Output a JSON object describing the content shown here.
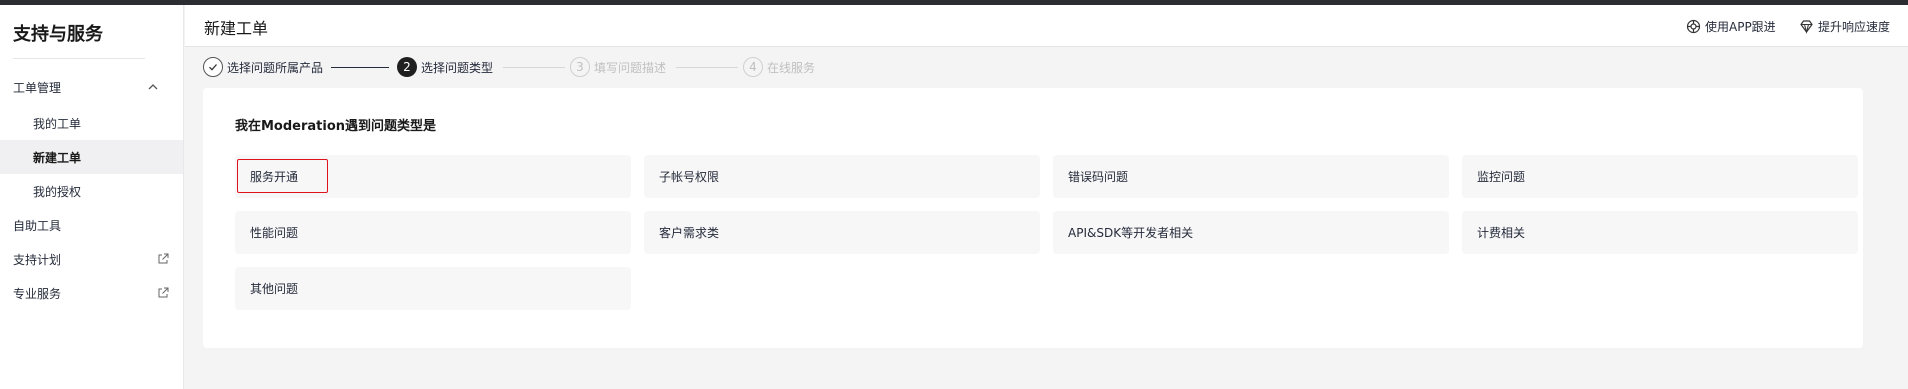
{
  "sidebar": {
    "title": "支持与服务",
    "group": {
      "label": "工单管理",
      "icon": "chevron-up-icon"
    },
    "sub_items": [
      {
        "label": "我的工单",
        "active": false
      },
      {
        "label": "新建工单",
        "active": true
      },
      {
        "label": "我的授权",
        "active": false
      }
    ],
    "items": [
      {
        "label": "自助工具",
        "icon": ""
      },
      {
        "label": "支持计划",
        "icon": "external-link-icon"
      },
      {
        "label": "专业服务",
        "icon": "external-link-icon"
      }
    ]
  },
  "header": {
    "title": "新建工单",
    "links": [
      {
        "label": "使用APP跟进",
        "icon": "app-icon"
      },
      {
        "label": "提升响应速度",
        "icon": "diamond-icon"
      }
    ]
  },
  "steps": [
    {
      "num": "✓",
      "label": "选择问题所属产品",
      "state": "done"
    },
    {
      "num": "2",
      "label": "选择问题类型",
      "state": "current"
    },
    {
      "num": "3",
      "label": "填写问题描述",
      "state": "todo"
    },
    {
      "num": "4",
      "label": "在线服务",
      "state": "todo"
    }
  ],
  "question": {
    "title": "我在Moderation遇到问题类型是",
    "options": [
      {
        "label": "服务开通",
        "selected": true
      },
      {
        "label": "子帐号权限",
        "selected": false
      },
      {
        "label": "错误码问题",
        "selected": false
      },
      {
        "label": "监控问题",
        "selected": false
      },
      {
        "label": "性能问题",
        "selected": false
      },
      {
        "label": "客户需求类",
        "selected": false
      },
      {
        "label": "API&SDK等开发者相关",
        "selected": false
      },
      {
        "label": "计费相关",
        "selected": false
      },
      {
        "label": "其他问题",
        "selected": false
      }
    ]
  },
  "colors": {
    "selected_border": "#e0121c",
    "active_bg": "#f0f0f2",
    "page_bg": "#f4f4f5"
  }
}
